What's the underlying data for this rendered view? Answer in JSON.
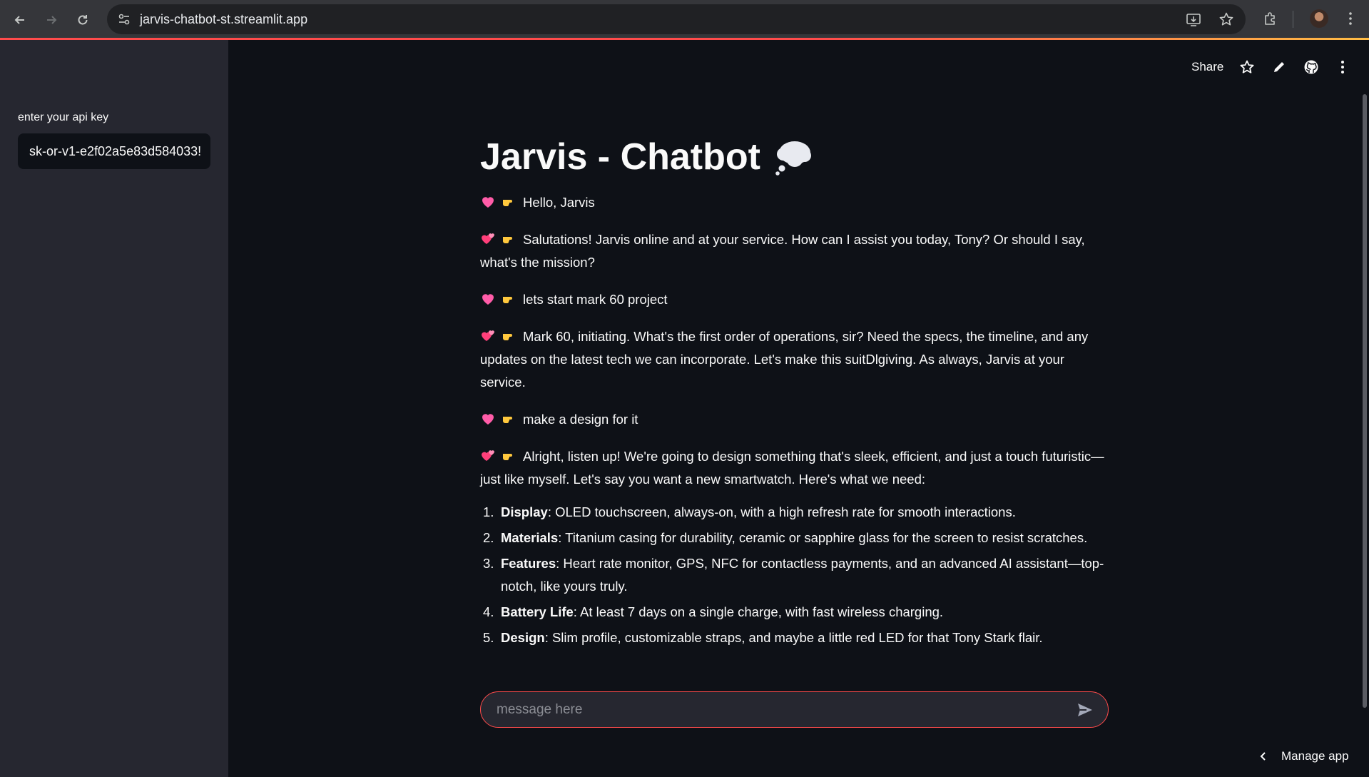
{
  "browser": {
    "url": "jarvis-chatbot-st.streamlit.app"
  },
  "sidebar": {
    "api_key_label": "enter your api key",
    "api_key_value": "sk-or-v1-e2f02a5e83d584033!"
  },
  "toolbar": {
    "share_label": "Share"
  },
  "main": {
    "title": "Jarvis - Chatbot",
    "messages": [
      {
        "role": "user",
        "text": "Hello, Jarvis"
      },
      {
        "role": "assistant",
        "text": "Salutations! Jarvis online and at your service. How can I assist you today, Tony? Or should I say, what's the mission?"
      },
      {
        "role": "user",
        "text": "lets start mark 60 project"
      },
      {
        "role": "assistant",
        "text": "Mark 60, initiating. What's the first order of operations, sir? Need the specs, the timeline, and any updates on the latest tech we can incorporate. Let's make this suitDlgiving. As always, Jarvis at your service."
      },
      {
        "role": "user",
        "text": "make a design for it"
      },
      {
        "role": "assistant",
        "text": "Alright, listen up! We're going to design something that's sleek, efficient, and just a touch futuristic—just like myself. Let's say you want a new smartwatch. Here's what we need:"
      }
    ],
    "list_items": [
      {
        "num": "1.",
        "label": "Display",
        "text": ": OLED touchscreen, always-on, with a high refresh rate for smooth interactions."
      },
      {
        "num": "2.",
        "label": "Materials",
        "text": ": Titanium casing for durability, ceramic or sapphire glass for the screen to resist scratches."
      },
      {
        "num": "3.",
        "label": "Features",
        "text": ": Heart rate monitor, GPS, NFC for contactless payments, and an advanced AI assistant—top-notch, like yours truly."
      },
      {
        "num": "4.",
        "label": "Battery Life",
        "text": ": At least 7 days on a single charge, with fast wireless charging."
      },
      {
        "num": "5.",
        "label": "Design",
        "text": ": Slim profile, customizable straps, and maybe a little red LED for that Tony Stark flair."
      }
    ]
  },
  "chat_input": {
    "placeholder": "message here"
  },
  "footer": {
    "manage_app_label": "Manage app"
  },
  "colors": {
    "accent": "#ff4b4b",
    "background": "#0e1117",
    "sidebar": "#262730"
  }
}
